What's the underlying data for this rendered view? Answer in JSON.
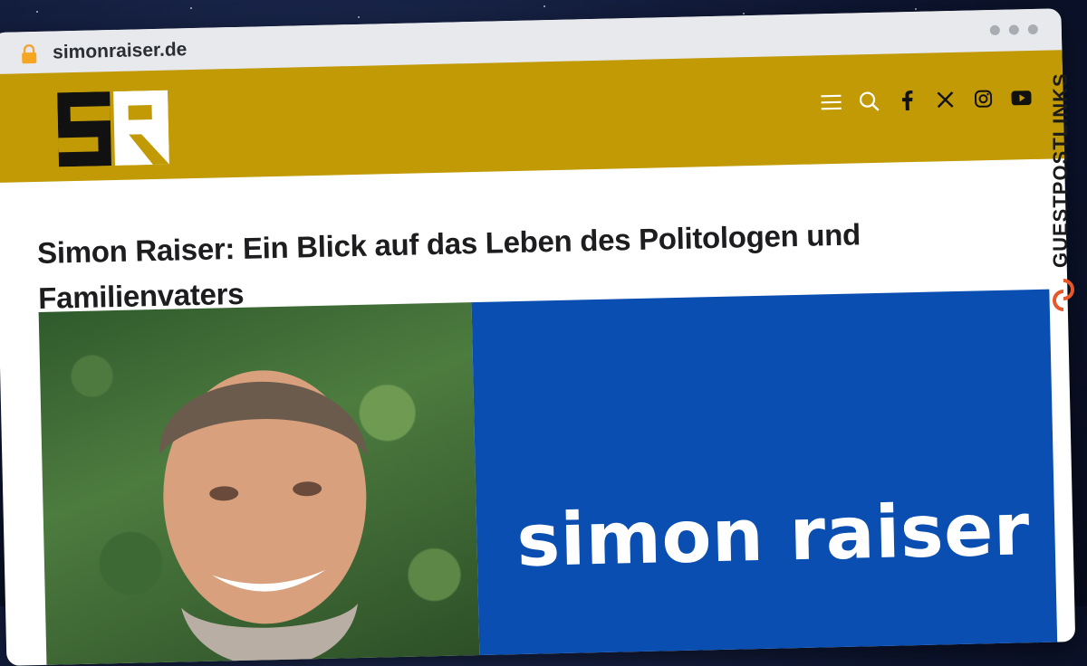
{
  "browser": {
    "url": "simonraiser.de"
  },
  "site": {
    "logo_text": "SR",
    "header_icons": [
      "menu-icon",
      "search-icon",
      "facebook-icon",
      "x-icon",
      "instagram-icon",
      "youtube-icon"
    ],
    "header_color": "#c19a05"
  },
  "article": {
    "title": "Simon Raiser: Ein Blick auf das Leben des Politologen und Familienvaters"
  },
  "hero": {
    "brand_text": "simon raiser",
    "panel_color": "#0a4eb1"
  },
  "badge": {
    "text": "GUESTPOSTLINKS"
  }
}
